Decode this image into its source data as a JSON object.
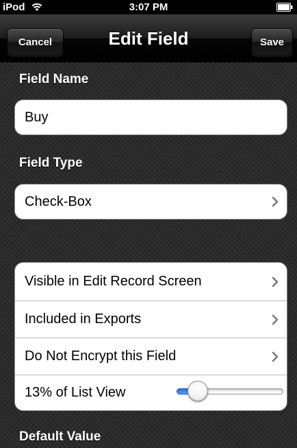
{
  "status_bar": {
    "carrier": "iPod",
    "time": "3:07 PM"
  },
  "nav": {
    "title": "Edit Field",
    "cancel_label": "Cancel",
    "save_label": "Save"
  },
  "field_name": {
    "header": "Field Name",
    "value": "Buy"
  },
  "field_type": {
    "header": "Field Type",
    "value": "Check-Box"
  },
  "options": {
    "items": [
      {
        "label": "Visible in Edit Record Screen"
      },
      {
        "label": "Included in Exports"
      },
      {
        "label": "Do Not Encrypt this Field"
      }
    ],
    "list_view_label": "13% of List View",
    "list_view_percent": 13
  },
  "default_value": {
    "header": "Default Value"
  },
  "colors": {
    "slider_fill": "#3b82e6",
    "nav_background": "#1a1a1a",
    "cell_background": "#ffffff"
  },
  "icons": {
    "wifi": "wifi-icon",
    "battery": "battery-icon",
    "chevron": "chevron-right-icon"
  }
}
